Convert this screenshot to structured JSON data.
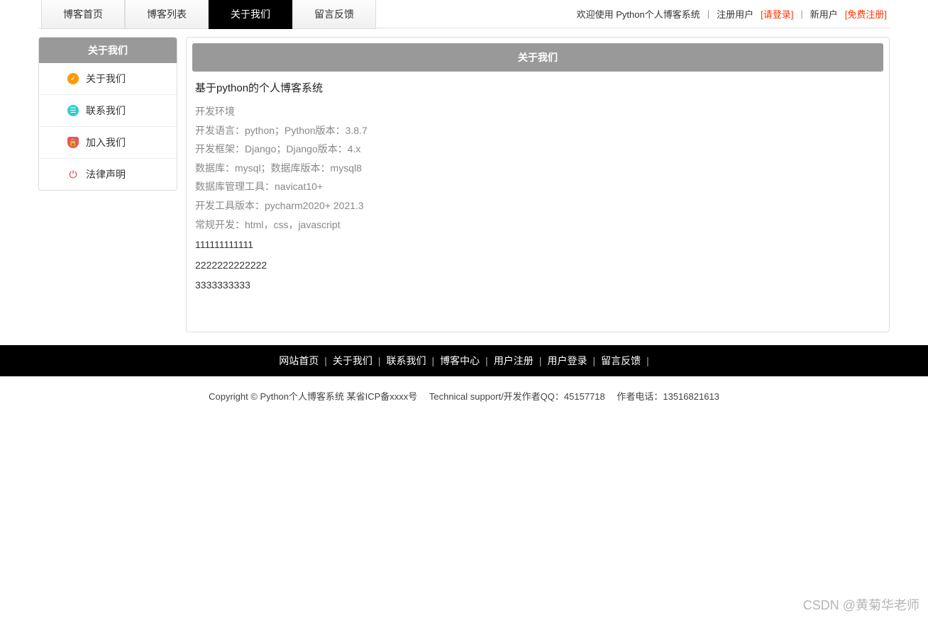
{
  "nav": {
    "tabs": [
      {
        "label": "博客首页"
      },
      {
        "label": "博客列表"
      },
      {
        "label": "关于我们"
      },
      {
        "label": "留言反馈"
      }
    ],
    "activeIndex": 2,
    "right": {
      "welcome": "欢迎使用 Python个人博客系统",
      "regUserLabel": "注册用户",
      "loginLink": "[请登录]",
      "newUserLabel": "新用户",
      "registerLink": "[免费注册]"
    }
  },
  "sidebar": {
    "title": "关于我们",
    "items": [
      {
        "label": "关于我们",
        "icon": "about"
      },
      {
        "label": "联系我们",
        "icon": "contact"
      },
      {
        "label": "加入我们",
        "icon": "join"
      },
      {
        "label": "法律声明",
        "icon": "legal"
      }
    ]
  },
  "content": {
    "header": "关于我们",
    "title": "基于python的个人博客系统",
    "lines": [
      "开发环境",
      "开发语言：python；Python版本：3.8.7",
      "开发框架：Django；Django版本：4.x",
      "数据库：mysql；数据库版本：mysql8",
      "数据库管理工具：navicat10+",
      "开发工具版本：pycharm2020+ 2021.3",
      "常规开发：html，css，javascript"
    ],
    "extras": [
      "111111111111",
      "2222222222222",
      "3333333333"
    ]
  },
  "footer": {
    "links": [
      "网站首页",
      "关于我们",
      "联系我们",
      "博客中心",
      "用户注册",
      "用户登录",
      "留言反馈"
    ],
    "copyright": "Copyright © Python个人博客系统 某省ICP备xxxx号　 Technical support/开发作者QQ：45157718　 作者电话：13516821613"
  },
  "watermark": "CSDN @黄菊华老师"
}
